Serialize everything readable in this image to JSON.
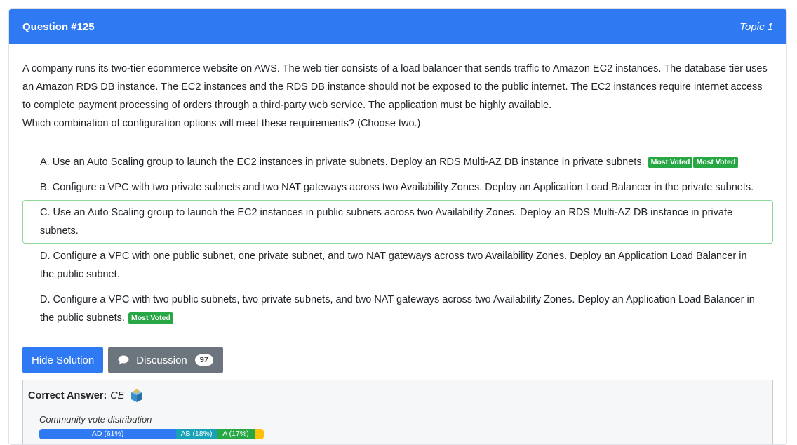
{
  "header": {
    "title": "Question #125",
    "topic": "Topic 1"
  },
  "question": {
    "paragraph1": "A company runs its two-tier ecommerce website on AWS. The web tier consists of a load balancer that sends traffic to Amazon EC2 instances. The database tier uses an Amazon RDS DB instance. The EC2 instances and the RDS DB instance should not be exposed to the public internet. The EC2 instances require internet access to complete payment processing of orders through a third-party web service. The application must be highly available.",
    "paragraph2": "Which combination of configuration options will meet these requirements? (Choose two.)"
  },
  "choices": [
    {
      "text": "A. Use an Auto Scaling group to launch the EC2 instances in private subnets. Deploy an RDS Multi-AZ DB instance in private subnets.",
      "badges": [
        "Most Voted",
        "Most Voted"
      ]
    },
    {
      "text": "B. Configure a VPC with two private subnets and two NAT gateways across two Availability Zones. Deploy an Application Load Balancer in the private subnets."
    },
    {
      "text": "C. Use an Auto Scaling group to launch the EC2 instances in public subnets across two Availability Zones. Deploy an RDS Multi-AZ DB instance in private subnets."
    },
    {
      "text": "D. Configure a VPC with one public subnet, one private subnet, and two NAT gateways across two Availability Zones. Deploy an Application Load Balancer in the public subnet."
    },
    {
      "text": "D. Configure a VPC with two public subnets, two private subnets, and two NAT gateways across two Availability Zones. Deploy an Application Load Balancer in the public subnets.",
      "badges": [
        "Most Voted"
      ]
    }
  ],
  "actions": {
    "hide_solution": "Hide Solution",
    "discussion": "Discussion",
    "discussion_count": "97"
  },
  "answer": {
    "label": "Correct Answer:",
    "value": "CE",
    "vote_title": "Community vote distribution",
    "votes": [
      {
        "label": "AD (61%)",
        "percent": 61,
        "color": "#2f79f2"
      },
      {
        "label": "AB (18%)",
        "percent": 18,
        "color": "#17a2b8"
      },
      {
        "label": "A (17%)",
        "percent": 17,
        "color": "#28a745"
      },
      {
        "label": "",
        "percent": 4,
        "color": "#ffc107"
      }
    ]
  },
  "colors": {
    "primary": "#2f79f2",
    "badge": "#28a745",
    "secondary": "#6c757d"
  }
}
